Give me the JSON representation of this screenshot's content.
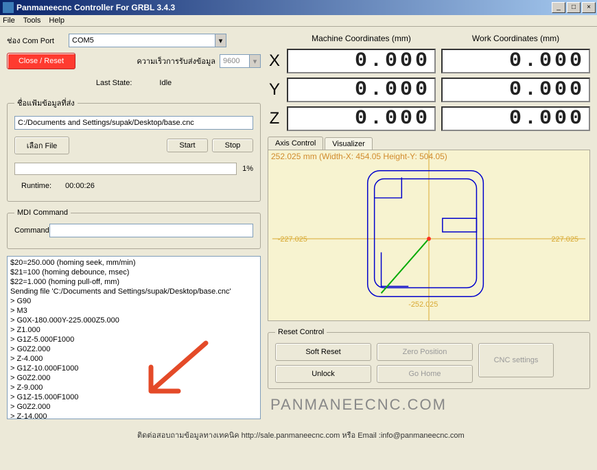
{
  "window": {
    "title": "Panmaneecnc Controller For GRBL 3.4.3"
  },
  "menu": {
    "file": "File",
    "tools": "Tools",
    "help": "Help"
  },
  "comport": {
    "label": "ช่อง Com Port",
    "value": "COM5"
  },
  "buttons": {
    "close_reset": "Close / Reset",
    "select_file": "เลือก File",
    "start": "Start",
    "stop": "Stop",
    "soft_reset": "Soft Reset",
    "unlock": "Unlock",
    "zero_position": "Zero Position",
    "go_home": "Go Home",
    "cnc_settings": "CNC settings"
  },
  "baud": {
    "label": "ความเร็วการรับส่งข้อมูล",
    "value": "9600"
  },
  "state": {
    "label": "Last State:",
    "value": "Idle"
  },
  "file_section": {
    "legend": "ชื่อแฟ้มข้อมูลที่ส่ง",
    "path": "C:/Documents and Settings/supak/Desktop/base.cnc",
    "progress_pct": "1%",
    "runtime_label": "Runtime:",
    "runtime": "00:00:26"
  },
  "mdi": {
    "legend": "MDI Command",
    "label": "Command"
  },
  "coords": {
    "machine_hdr": "Machine Coordinates   (mm)",
    "work_hdr": "Work Coordinates      (mm)",
    "axes": [
      "X",
      "Y",
      "Z"
    ],
    "machine": [
      "0.000",
      "0.000",
      "0.000"
    ],
    "work": [
      "0.000",
      "0.000",
      "0.000"
    ]
  },
  "tabs": {
    "axis": "Axis Control",
    "viz": "Visualizer"
  },
  "viz": {
    "info": "252.025 mm  (Width-X: 454.05  Height-Y: 504.05)",
    "xneg": "-227.025",
    "xpos": "227.025",
    "yneg": "-252.025"
  },
  "reset": {
    "legend": "Reset Control"
  },
  "console_lines": [
    "$20=250.000 (homing seek, mm/min)",
    "$21=100 (homing debounce, msec)",
    "$22=1.000 (homing pull-off, mm)",
    "Sending file 'C:/Documents and Settings/supak/Desktop/base.cnc'",
    "> G90",
    "> M3",
    "> G0X-180.000Y-225.000Z5.000",
    "> Z1.000",
    "> G1Z-5.000F1000",
    "> G0Z2.000",
    "> Z-4.000",
    "> G1Z-10.000F1000",
    "> G0Z2.000",
    "> Z-9.000",
    "> G1Z-15.000F1000",
    "> G0Z2.000",
    "> Z-14.000"
  ],
  "watermark": "PANMANEECNC.COM",
  "footer": "ติดต่อสอบถามข้อมูลทางเทคนิค http://sale.panmaneecnc.com  หรือ Email :info@panmaneecnc.com"
}
